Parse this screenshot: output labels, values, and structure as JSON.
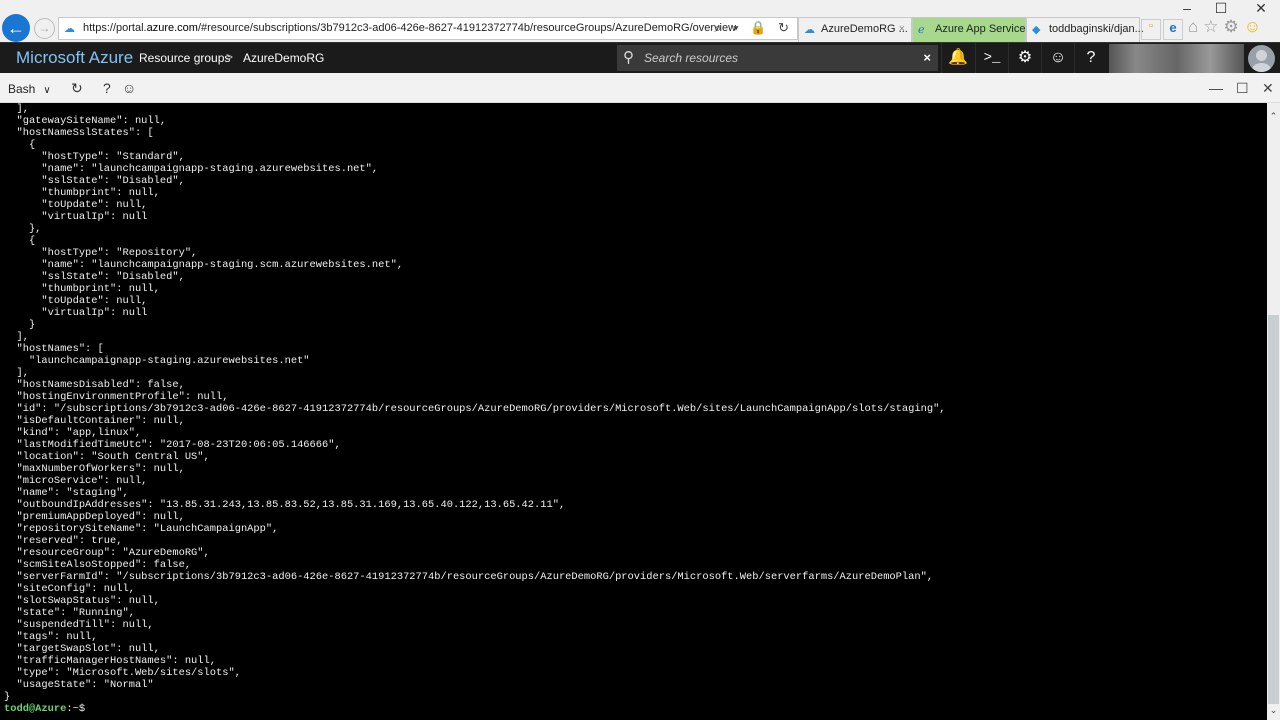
{
  "browser": {
    "url_prefix": "https://portal.",
    "url_domain": "azure.com",
    "url_rest": "/#resource/subscriptions/3b7912c3-ad06-426e-8627-41912372774b/resourceGroups/AzureDemoRG/overview",
    "addr_tools": "⌕ ▾ 🔒 ↻",
    "tabs": [
      {
        "label": "AzureDemoRG ...",
        "icon": "☁",
        "close": "×",
        "active": false
      },
      {
        "label": "Azure App Service",
        "icon": "ℯ",
        "active": true
      },
      {
        "label": "toddbaginski/djan...",
        "icon": "◆",
        "active": false
      }
    ],
    "new_tab_glyph": "▫",
    "ie_glyph": "e",
    "toolbar_glyphs": [
      "⌂",
      "☆",
      "⚙",
      "☺"
    ],
    "window_controls": [
      "–",
      "☐",
      "✕"
    ]
  },
  "azure_header": {
    "brand": "Microsoft Azure",
    "breadcrumb": [
      "Resource groups",
      "AzureDemoRG"
    ],
    "breadcrumb_sep": ">",
    "search_placeholder": "Search resources",
    "search_clear": "×",
    "buttons": [
      {
        "name": "notifications",
        "glyph": "🔔"
      },
      {
        "name": "cloud-shell",
        "glyph": ">_"
      },
      {
        "name": "settings",
        "glyph": "⚙"
      },
      {
        "name": "feedback",
        "glyph": "☺"
      },
      {
        "name": "help",
        "glyph": "?"
      }
    ]
  },
  "shell_toolbar": {
    "shell_type": "Bash",
    "chevron": "∨",
    "restart_glyph": "↻",
    "help_glyph": "?",
    "feedback_glyph": "☺",
    "minimize": "—",
    "maximize": "☐",
    "close": "✕"
  },
  "terminal": {
    "lines": [
      "],",
      "\"gatewaySiteName\": null,",
      "\"hostNameSslStates\": [",
      "  {",
      "    \"hostType\": \"Standard\",",
      "    \"name\": \"launchcampaignapp-staging.azurewebsites.net\",",
      "    \"sslState\": \"Disabled\",",
      "    \"thumbprint\": null,",
      "    \"toUpdate\": null,",
      "    \"virtualIp\": null",
      "  },",
      "  {",
      "    \"hostType\": \"Repository\",",
      "    \"name\": \"launchcampaignapp-staging.scm.azurewebsites.net\",",
      "    \"sslState\": \"Disabled\",",
      "    \"thumbprint\": null,",
      "    \"toUpdate\": null,",
      "    \"virtualIp\": null",
      "  }",
      "],",
      "\"hostNames\": [",
      "  \"launchcampaignapp-staging.azurewebsites.net\"",
      "],",
      "\"hostNamesDisabled\": false,",
      "\"hostingEnvironmentProfile\": null,",
      "\"id\": \"/subscriptions/3b7912c3-ad06-426e-8627-41912372774b/resourceGroups/AzureDemoRG/providers/Microsoft.Web/sites/LaunchCampaignApp/slots/staging\",",
      "\"isDefaultContainer\": null,",
      "\"kind\": \"app,linux\",",
      "\"lastModifiedTimeUtc\": \"2017-08-23T20:06:05.146666\",",
      "\"location\": \"South Central US\",",
      "\"maxNumberOfWorkers\": null,",
      "\"microService\": null,",
      "\"name\": \"staging\",",
      "\"outboundIpAddresses\": \"13.85.31.243,13.85.83.52,13.85.31.169,13.65.40.122,13.65.42.11\",",
      "\"premiumAppDeployed\": null,",
      "\"repositorySiteName\": \"LaunchCampaignApp\",",
      "\"reserved\": true,",
      "\"resourceGroup\": \"AzureDemoRG\",",
      "\"scmSiteAlsoStopped\": false,",
      "\"serverFarmId\": \"/subscriptions/3b7912c3-ad06-426e-8627-41912372774b/resourceGroups/AzureDemoRG/providers/Microsoft.Web/serverfarms/AzureDemoPlan\",",
      "\"siteConfig\": null,",
      "\"slotSwapStatus\": null,",
      "\"state\": \"Running\",",
      "\"suspendedTill\": null,",
      "\"tags\": null,",
      "\"targetSwapSlot\": null,",
      "\"trafficManagerHostNames\": null,",
      "\"type\": \"Microsoft.Web/sites/slots\",",
      "\"usageState\": \"Normal\""
    ],
    "closing_brace": "}",
    "prompt": "todd@Azure",
    "prompt_tail": ":~$",
    "scroll_position_fraction": 1.0,
    "visible_fraction": 0.67
  },
  "scrollbar": {
    "up_glyph": "⌃",
    "down_glyph": "⌄"
  }
}
